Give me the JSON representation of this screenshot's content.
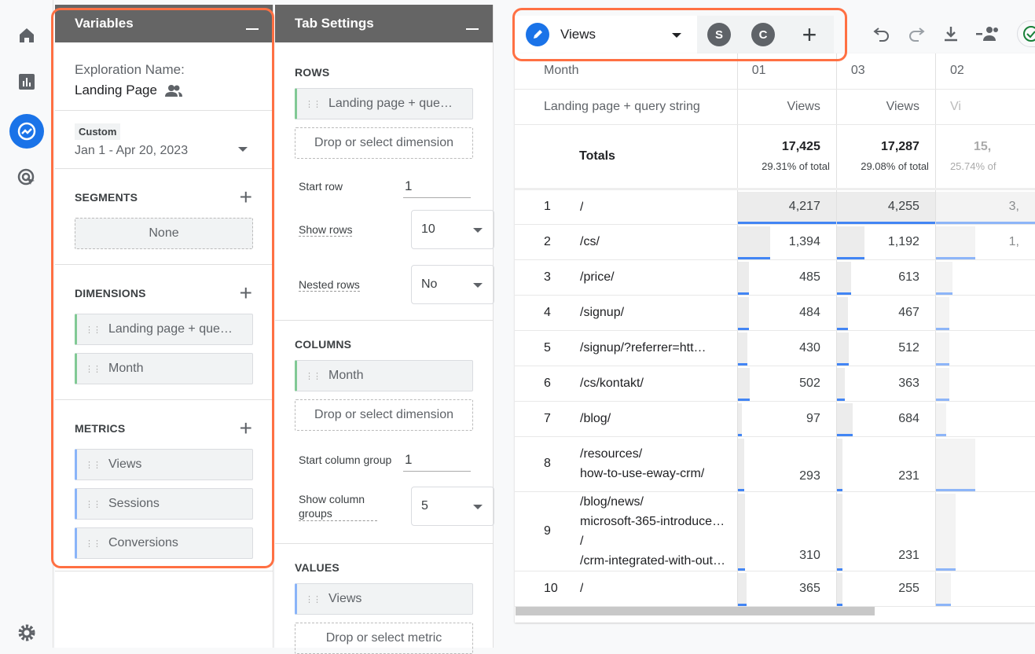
{
  "colors": {
    "accent": "#1a73e8",
    "highlight": "#ff7043",
    "header": "#656565",
    "bar": "#4285f4"
  },
  "nav": [
    {
      "icon": "home-icon"
    },
    {
      "icon": "reports-icon"
    },
    {
      "icon": "explore-icon",
      "active": true
    },
    {
      "icon": "advertising-icon"
    },
    {
      "icon": "settings-icon"
    }
  ],
  "variables": {
    "title": "Variables",
    "exploration_label": "Exploration Name:",
    "exploration_name": "Landing Page",
    "date_badge": "Custom",
    "date_range": "Jan 1 - Apr 20, 2023",
    "segments_label": "SEGMENTS",
    "segments": [
      "None"
    ],
    "dimensions_label": "DIMENSIONS",
    "dimensions": [
      "Landing page + que…",
      "Month"
    ],
    "metrics_label": "METRICS",
    "metrics": [
      "Views",
      "Sessions",
      "Conversions"
    ]
  },
  "tab_settings": {
    "title": "Tab Settings",
    "rows_label": "ROWS",
    "rows": [
      "Landing page + que…"
    ],
    "drop_dimension": "Drop or select dimension",
    "start_row_label": "Start row",
    "start_row": "1",
    "show_rows_label": "Show rows",
    "show_rows": "10",
    "nested_rows_label": "Nested rows",
    "nested_rows": "No",
    "columns_label": "COLUMNS",
    "columns": [
      "Month"
    ],
    "start_col_label": "Start column group",
    "start_col": "1",
    "show_col_label": "Show column groups",
    "show_col": "5",
    "values_label": "VALUES",
    "values": [
      "Views"
    ],
    "drop_metric": "Drop or select metric"
  },
  "tabs": {
    "active": "Views",
    "others": [
      "S",
      "C"
    ],
    "add": "+"
  },
  "table": {
    "row_dim_header": "Month",
    "col_dim_header": "Landing page + query string",
    "columns": [
      {
        "month": "01",
        "metric": "Views",
        "total": "17,425",
        "pct": "29.31% of total"
      },
      {
        "month": "03",
        "metric": "Views",
        "total": "17,287",
        "pct": "29.08% of total"
      },
      {
        "month": "02",
        "metric": "Vi",
        "total": "15,",
        "pct": "25.74% of"
      }
    ],
    "totals_label": "Totals",
    "rows": [
      {
        "n": "1",
        "page": [
          "/"
        ],
        "vals": [
          "4,217",
          "4,255",
          "3,"
        ],
        "raw": [
          4217,
          4255,
          3000
        ]
      },
      {
        "n": "2",
        "page": [
          "/cs/"
        ],
        "vals": [
          "1,394",
          "1,192",
          "1,"
        ],
        "raw": [
          1394,
          1192,
          1200
        ]
      },
      {
        "n": "3",
        "page": [
          "/price/"
        ],
        "vals": [
          "485",
          "613",
          ""
        ],
        "raw": [
          485,
          613,
          500
        ]
      },
      {
        "n": "4",
        "page": [
          "/signup/"
        ],
        "vals": [
          "484",
          "467",
          ""
        ],
        "raw": [
          484,
          467,
          400
        ]
      },
      {
        "n": "5",
        "page": [
          "/signup/?referrer=htt…"
        ],
        "vals": [
          "430",
          "512",
          ""
        ],
        "raw": [
          430,
          512,
          400
        ]
      },
      {
        "n": "6",
        "page": [
          "/cs/kontakt/"
        ],
        "vals": [
          "502",
          "363",
          ""
        ],
        "raw": [
          502,
          363,
          400
        ]
      },
      {
        "n": "7",
        "page": [
          "/blog/"
        ],
        "vals": [
          "97",
          "684",
          ""
        ],
        "raw": [
          97,
          684,
          300
        ]
      },
      {
        "n": "8",
        "page": [
          "/resources/",
          "how-to-use-eway-crm/"
        ],
        "vals": [
          "293",
          "231",
          ""
        ],
        "raw": [
          293,
          231,
          1200
        ]
      },
      {
        "n": "9",
        "page": [
          "/blog/news/",
          "microsoft-365-introduce…",
          "/",
          "/crm-integrated-with-out…"
        ],
        "vals": [
          "310",
          "231",
          ""
        ],
        "raw": [
          310,
          231,
          600
        ]
      },
      {
        "n": "10",
        "page": [
          "/"
        ],
        "vals": [
          "365",
          "255",
          ""
        ],
        "raw": [
          365,
          255,
          450
        ]
      }
    ]
  }
}
